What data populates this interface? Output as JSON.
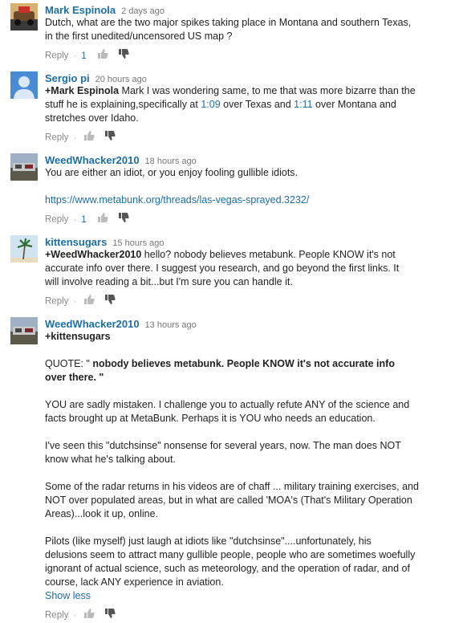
{
  "comments": [
    {
      "author": "Mark Espinola",
      "time": "2 days ago",
      "lines": [
        "Dutch, what are the two major spikes taking place in Montana and southern Texas,",
        "in the first unedited/uncensored US map ?"
      ],
      "reply": "Reply",
      "separator": "·",
      "likes": "1"
    },
    {
      "author": "Sergio pi",
      "time": "20 hours ago",
      "mention": "+Mark Espinola",
      "text_a": " Mark I was wondering same, to me that was more bizarre  than the",
      "text_b": "stuff he is explaining,specifically at ",
      "ts1": "1:09",
      "text_c": " over Texas and ",
      "ts2": "1:11",
      "text_d": " over Montana and",
      "text_e": "stretches over Idaho.",
      "reply": "Reply",
      "separator": "·"
    },
    {
      "author": "WeedWhacker2010",
      "time": "18 hours ago",
      "line1": "You are either an idiot, or you enjoy fooling gullible idiots.",
      "url": "https://www.metabunk.org/threads/las-vegas-sprayed.3232/",
      "reply": "Reply",
      "separator": "·",
      "likes": "1"
    },
    {
      "author": "kittensugars",
      "time": "15 hours ago",
      "mention": "+WeedWhacker2010",
      "line1": " hello?  nobody believes metabunk.  People KNOW it's not",
      "line2": "accurate info over there.  I suggest you research, and go beyond the first links.  It",
      "line3": "will involve reading a bit...but I'm sure you can handle it.",
      "reply": "Reply",
      "separator": "·"
    },
    {
      "author": "WeedWhacker2010",
      "time": "13 hours ago",
      "mention": "+kittensugars",
      "quote_prefix": "QUOTE:  \"",
      "quote_l1": " nobody believes metabunk.  People KNOW it's not accurate info",
      "quote_l2": "over there. \"",
      "p1a": "YOU are sadly mistaken.  I challenge you to actually refute ANY of the science and",
      "p1b": "facts brought up at MetaBunk.  Perhaps it is YOU who needs an education.",
      "p2a": "I've seen this \"dutchsinse\" nonsense for several years, now.  The man does NOT",
      "p2b": "know what he's talking about.",
      "p3a": "Some of the radar returns in his videos are of chaff ... military training exercises, and",
      "p3b": "NOT over populated areas, but in what are called 'MOA's  (That's Military Operation",
      "p3c": "Areas)...look it up, online.",
      "p4a": "Pilots (like myself) just laugh at idiots like \"dutchsinse\"....unfortunately, his",
      "p4b": "delusions seem to attract many gullible people, people who are sometimes woefully",
      "p4c": "ignorant of actual science, such as meteorology, and the operation of radar, and of",
      "p4d": "course, lack ANY experience in aviation.",
      "show_less": "Show less",
      "reply": "Reply",
      "separator": "·"
    }
  ],
  "icons": {
    "like": "thumbs-up-icon",
    "dislike": "thumbs-down-icon"
  },
  "colors": {
    "author": "#1b6ea8",
    "link": "#1b6ea8",
    "muted": "#888888"
  }
}
